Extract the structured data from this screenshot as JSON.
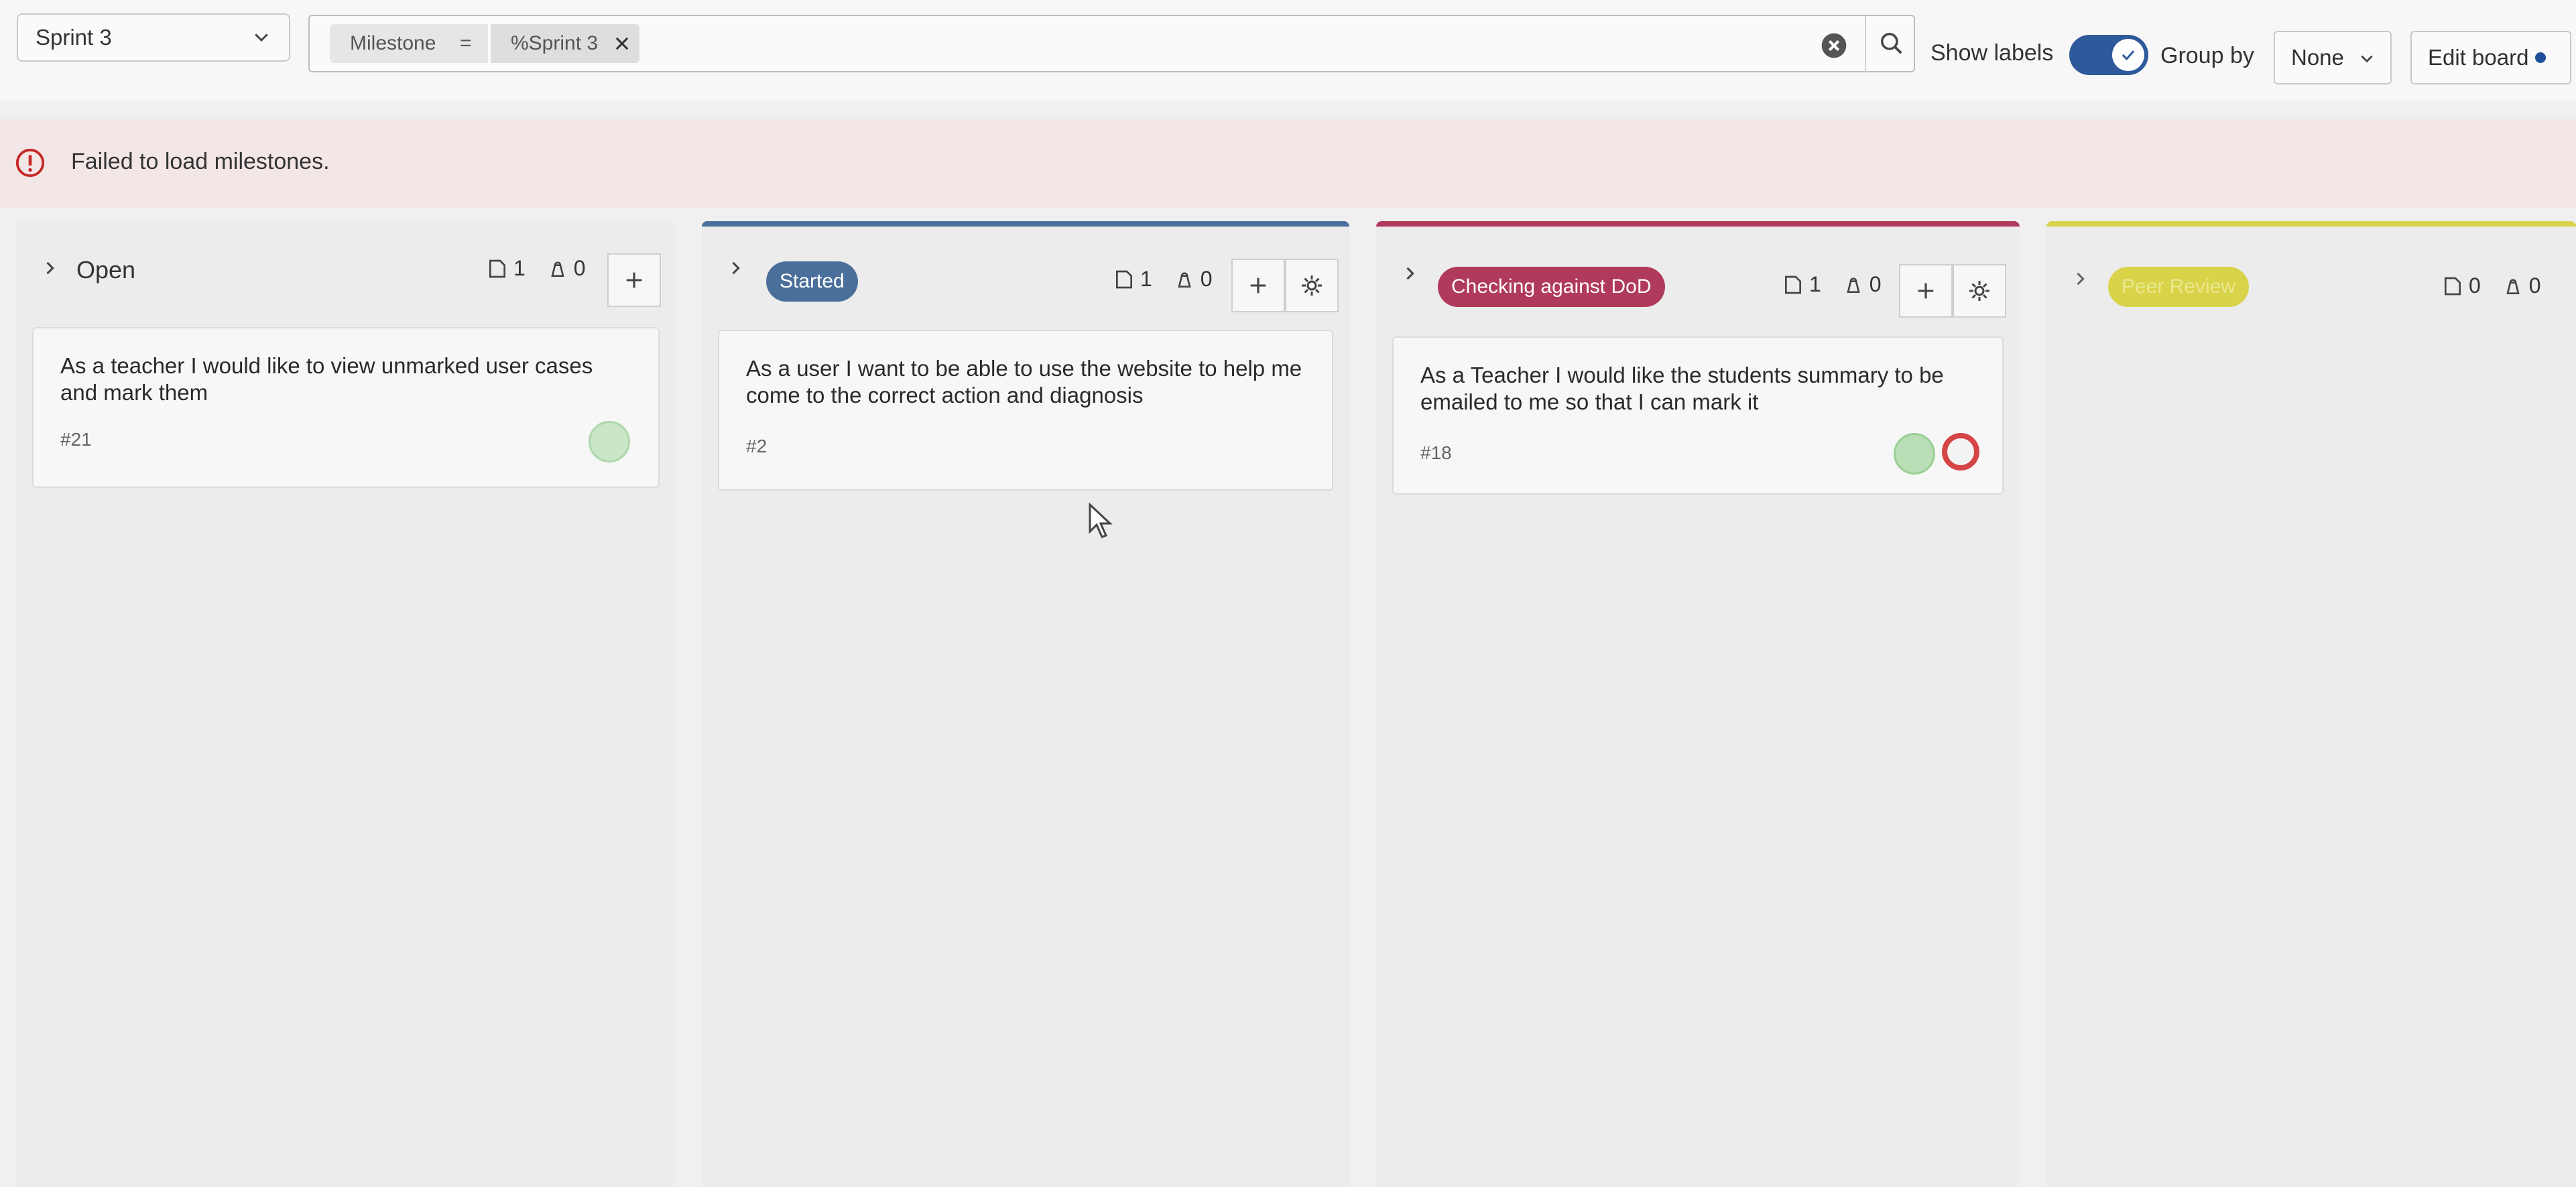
{
  "sprint_select": {
    "value": "Sprint 3"
  },
  "filter": {
    "token_key": "Milestone",
    "token_op": "=",
    "token_value": "%Sprint 3"
  },
  "toolbar": {
    "show_labels_text": "Show labels",
    "show_labels_on": true,
    "group_by_text": "Group by",
    "group_by_value": "None",
    "edit_board_label": "Edit board"
  },
  "alert": {
    "message": "Failed to load milestones."
  },
  "columns": [
    {
      "title": "Open",
      "issue_count": "1",
      "weight_count": "0",
      "cards": [
        {
          "title": "As a teacher I would like to view unmarked user cases and mark them",
          "ref": "#21"
        }
      ]
    },
    {
      "title": "Started",
      "color": "#4a6f9a",
      "issue_count": "1",
      "weight_count": "0",
      "cards": [
        {
          "title": "As a user I want to be able to use the website to help me come to the correct action and diagnosis",
          "ref": "#2"
        }
      ]
    },
    {
      "title": "Checking against DoD",
      "color": "#b03a5b",
      "issue_count": "1",
      "weight_count": "0",
      "cards": [
        {
          "title": "As a Teacher I would like the students summary to be emailed to me so that I can mark it",
          "ref": "#18"
        }
      ]
    },
    {
      "title": "Peer Review",
      "color": "#d9d34a",
      "issue_count": "0",
      "weight_count": "0",
      "cards": []
    }
  ],
  "icons": {
    "chevron": "chevron-down-icon",
    "clear": "clear-icon",
    "search": "search-icon",
    "issues": "issues-icon",
    "weight": "weight-icon",
    "plus": "plus-icon",
    "settings": "gear-icon",
    "warning": "warning-icon"
  }
}
